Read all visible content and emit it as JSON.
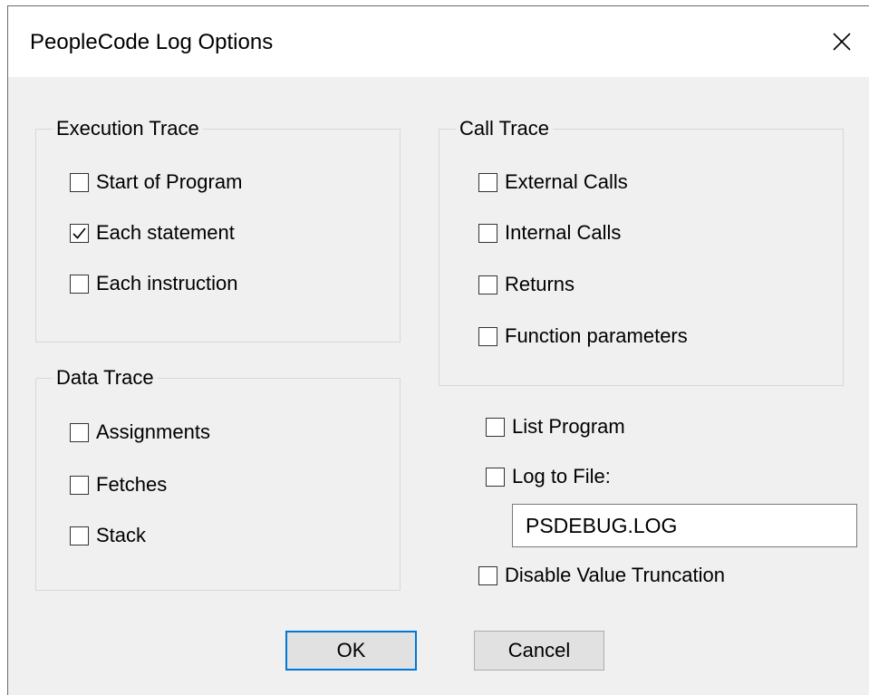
{
  "window": {
    "title": "PeopleCode Log Options"
  },
  "icons": {
    "close": "close-icon",
    "checkmark": "checkmark-icon"
  },
  "execution_trace": {
    "legend": "Execution Trace",
    "items": [
      {
        "label": "Start of Program",
        "checked": false
      },
      {
        "label": "Each statement",
        "checked": true
      },
      {
        "label": "Each instruction",
        "checked": false
      }
    ]
  },
  "call_trace": {
    "legend": "Call Trace",
    "items": [
      {
        "label": "External Calls",
        "checked": false
      },
      {
        "label": "Internal Calls",
        "checked": false
      },
      {
        "label": "Returns",
        "checked": false
      },
      {
        "label": "Function parameters",
        "checked": false
      }
    ]
  },
  "data_trace": {
    "legend": "Data Trace",
    "items": [
      {
        "label": "Assignments",
        "checked": false
      },
      {
        "label": "Fetches",
        "checked": false
      },
      {
        "label": "Stack",
        "checked": false
      }
    ]
  },
  "options": {
    "list_program": {
      "label": "List Program",
      "checked": false
    },
    "log_to_file": {
      "label": "Log to File:",
      "checked": false
    },
    "log_file_value": "PSDEBUG.LOG",
    "disable_truncation": {
      "label": "Disable Value Truncation",
      "checked": false
    }
  },
  "buttons": {
    "ok": "OK",
    "cancel": "Cancel"
  },
  "colors": {
    "dialog_bg": "#f0f0f0",
    "default_button_border": "#0078d7"
  }
}
